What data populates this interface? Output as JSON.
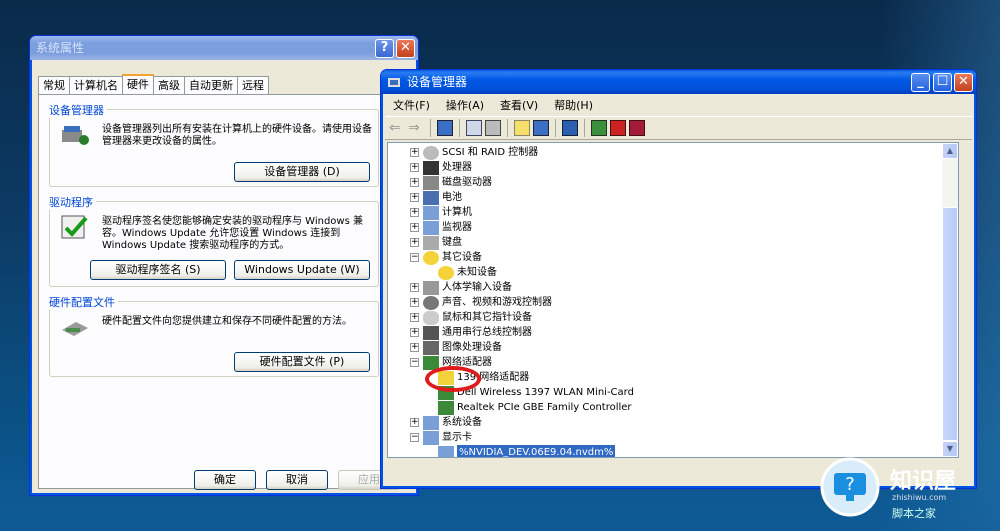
{
  "sysprops": {
    "title": "系统属性",
    "tabs": [
      "常规",
      "计算机名",
      "硬件",
      "高级",
      "自动更新",
      "远程"
    ],
    "groups": {
      "devmgr": {
        "label": "设备管理器",
        "text": "设备管理器列出所有安装在计算机上的硬件设备。请使用设备管理器来更改设备的属性。",
        "button": "设备管理器 (D)"
      },
      "drivers": {
        "label": "驱动程序",
        "text": "驱动程序签名使您能够确定安装的驱动程序与 Windows 兼容。Windows Update 允许您设置 Windows 连接到 Windows Update 搜索驱动程序的方式。",
        "button1": "驱动程序签名 (S)",
        "button2": "Windows Update (W)"
      },
      "profiles": {
        "label": "硬件配置文件",
        "text": "硬件配置文件向您提供建立和保存不同硬件配置的方法。",
        "button": "硬件配置文件 (P)"
      }
    },
    "ok": "确定",
    "cancel": "取消",
    "apply": "应用"
  },
  "devmgr": {
    "title": "设备管理器",
    "menu": [
      "文件(F)",
      "操作(A)",
      "查看(V)",
      "帮助(H)"
    ],
    "tree": [
      {
        "t": "SCSI 和 RAID 控制器",
        "icon": "scsi-icon"
      },
      {
        "t": "处理器",
        "icon": "cpu-icon"
      },
      {
        "t": "磁盘驱动器",
        "icon": "disk-icon"
      },
      {
        "t": "电池",
        "icon": "battery-icon"
      },
      {
        "t": "计算机",
        "icon": "computer-icon"
      },
      {
        "t": "监视器",
        "icon": "monitor-icon"
      },
      {
        "t": "键盘",
        "icon": "keyboard-icon"
      },
      {
        "t": "其它设备",
        "icon": "unknown-device-icon"
      },
      {
        "t": "未知设备",
        "icon": "unknown-device-icon"
      },
      {
        "t": "人体学输入设备",
        "icon": "hid-icon"
      },
      {
        "t": "声音、视频和游戏控制器",
        "icon": "sound-icon"
      },
      {
        "t": "鼠标和其它指针设备",
        "icon": "mouse-icon"
      },
      {
        "t": "通用串行总线控制器",
        "icon": "usb-icon"
      },
      {
        "t": "图像处理设备",
        "icon": "camera-icon"
      },
      {
        "t": "网络适配器",
        "icon": "network-icon"
      },
      {
        "t": "139 网络适配器",
        "icon": "network-warning-icon"
      },
      {
        "t": "Dell Wireless 1397 WLAN Mini-Card",
        "icon": "network-icon"
      },
      {
        "t": "Realtek PCIe GBE Family Controller",
        "icon": "network-icon"
      },
      {
        "t": "系统设备",
        "icon": "computer-icon"
      },
      {
        "t": "显示卡",
        "icon": "display-icon"
      },
      {
        "t": "%NVIDIA_DEV.06E9.04.nvdm%",
        "icon": "display-icon"
      }
    ]
  },
  "logo": {
    "text": "知识屋",
    "sub": "zhishiwu.com",
    "sub2": "脚本之家"
  }
}
